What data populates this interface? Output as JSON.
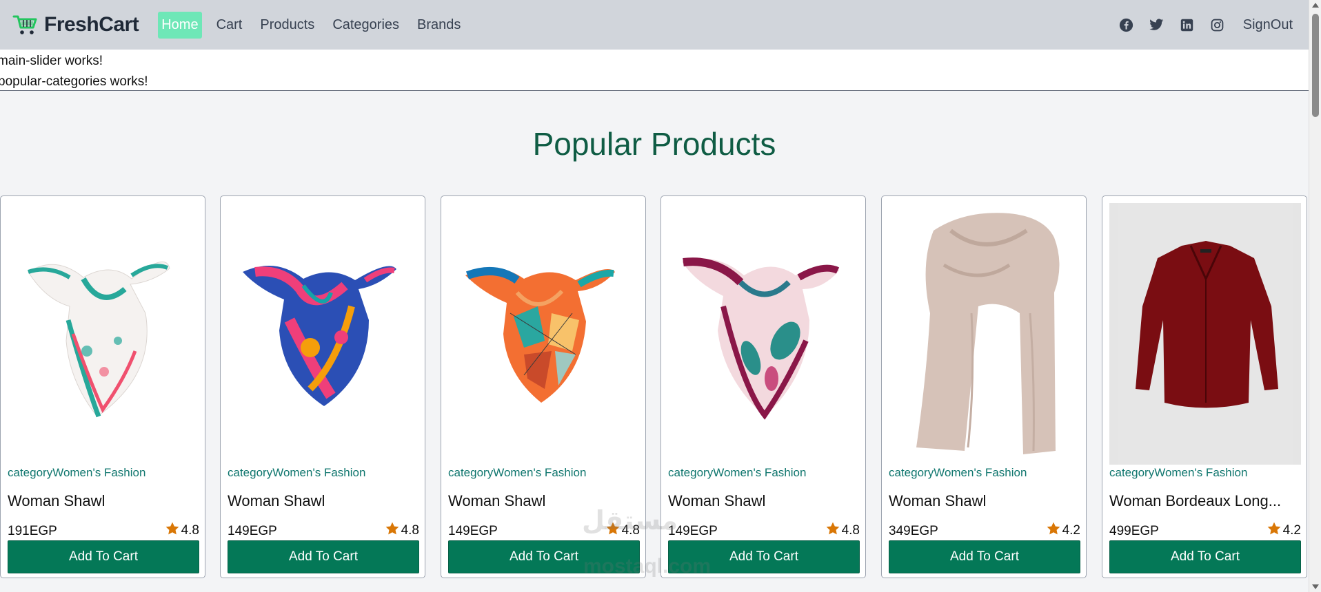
{
  "brand": {
    "name": "FreshCart",
    "logo_icon": "cart-icon",
    "logo_color": "#22c55e"
  },
  "nav": {
    "links": [
      {
        "label": "Home",
        "active": true
      },
      {
        "label": "Cart",
        "active": false
      },
      {
        "label": "Products",
        "active": false
      },
      {
        "label": "Categories",
        "active": false
      },
      {
        "label": "Brands",
        "active": false
      }
    ],
    "social_icons": [
      "facebook-icon",
      "twitter-icon",
      "linkedin-icon",
      "instagram-icon"
    ],
    "signout_label": "SignOut"
  },
  "test_lines": {
    "main_slider": "main-slider works!",
    "popular_categories": "popular-categories works!"
  },
  "section": {
    "title": "Popular Products"
  },
  "products": [
    {
      "category": "categoryWomen's Fashion",
      "title": "Woman Shawl",
      "price": "191EGP",
      "rating": "4.8",
      "button": "Add To Cart"
    },
    {
      "category": "categoryWomen's Fashion",
      "title": "Woman Shawl",
      "price": "149EGP",
      "rating": "4.8",
      "button": "Add To Cart"
    },
    {
      "category": "categoryWomen's Fashion",
      "title": "Woman Shawl",
      "price": "149EGP",
      "rating": "4.8",
      "button": "Add To Cart"
    },
    {
      "category": "categoryWomen's Fashion",
      "title": "Woman Shawl",
      "price": "149EGP",
      "rating": "4.8",
      "button": "Add To Cart"
    },
    {
      "category": "categoryWomen's Fashion",
      "title": "Woman Shawl",
      "price": "349EGP",
      "rating": "4.2",
      "button": "Add To Cart"
    },
    {
      "category": "categoryWomen's Fashion",
      "title": "Woman Bordeaux Long...",
      "price": "499EGP",
      "rating": "4.2",
      "button": "Add To Cart"
    }
  ],
  "colors": {
    "navbar_bg": "#d1d5db",
    "active_link_bg": "#6ee7b7",
    "accent": "#047857",
    "heading": "#0f5c44",
    "star": "#d97706"
  },
  "watermark": {
    "arabic": "مستقل",
    "latin": "mostaql.com"
  }
}
